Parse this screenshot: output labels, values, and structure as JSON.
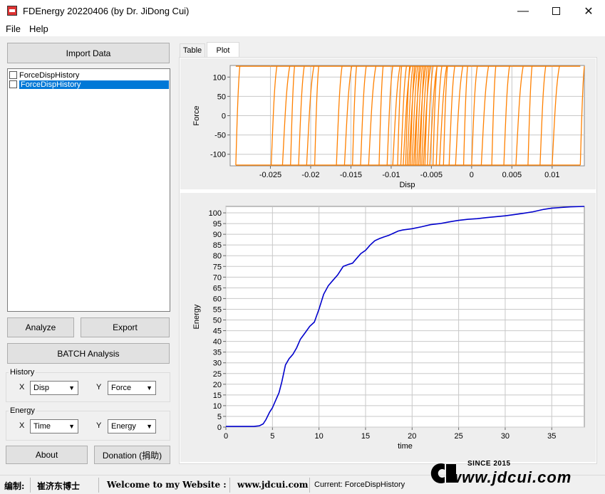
{
  "window": {
    "title": "FDEnergy 20220406 (by Dr. JiDong Cui)"
  },
  "menu": [
    "File",
    "Help"
  ],
  "left": {
    "import_label": "Import Data",
    "tree_items": [
      "ForceDispHistory",
      "ForceDispHistory"
    ],
    "analyze_label": "Analyze",
    "export_label": "Export",
    "batch_label": "BATCH Analysis",
    "history": {
      "label": "History",
      "x_label": "X",
      "y_label": "Y",
      "x_value": "Disp",
      "y_value": "Force"
    },
    "energy": {
      "label": "Energy",
      "x_label": "X",
      "y_label": "Y",
      "x_value": "Time",
      "y_value": "Energy"
    },
    "about_label": "About",
    "donation_label": "Donation (捐助)"
  },
  "tabs": [
    "Table",
    "Plot"
  ],
  "status": {
    "editor_label": "编制:",
    "editor_name": "崔济东博士",
    "welcome": "Welcome to my Website :",
    "website": "www.jdcui.com",
    "current": "Current: ForceDispHistory"
  },
  "brand": {
    "since": "SINCE 2015",
    "url": "www.jdcui.com"
  },
  "colors": {
    "hysteresis": "#ff8000",
    "energy": "#0000cc",
    "selection": "#0078d7"
  },
  "chart_data": [
    {
      "type": "line",
      "xlabel": "Disp",
      "ylabel": "Force",
      "xlim": [
        -0.03,
        0.014
      ],
      "ylim": [
        -130,
        130
      ],
      "xticks": [
        "-0.025",
        "-0.02",
        "-0.015",
        "-0.01",
        "-0.005",
        "0",
        "0.005",
        "0.01"
      ],
      "yticks": [
        "100",
        "50",
        "0",
        "-50",
        "-100"
      ],
      "grid": true,
      "force_levels": [
        -128,
        128
      ],
      "reversal_disps": [
        -0.0293,
        -0.0249,
        -0.0235,
        -0.0225,
        -0.0215,
        -0.0205,
        -0.0195,
        -0.0168,
        -0.0158,
        -0.0148,
        -0.0138,
        -0.0128,
        -0.0115,
        -0.0105,
        -0.0098,
        -0.0092,
        -0.0088,
        -0.0085,
        -0.0082,
        -0.008,
        -0.0078,
        -0.0076,
        -0.0074,
        -0.0072,
        -0.007,
        -0.0068,
        -0.0066,
        -0.0064,
        -0.0062,
        -0.006,
        -0.0058,
        -0.0055,
        -0.0052,
        -0.0048,
        -0.0044,
        -0.004,
        -0.0035,
        -0.0028,
        -0.002,
        -0.001,
        0.0,
        0.0012,
        0.0025,
        0.004,
        0.0055,
        0.007,
        0.0085,
        0.01,
        0.0135
      ]
    },
    {
      "type": "line",
      "xlabel": "time",
      "ylabel": "Energy",
      "xlim": [
        0,
        38.5
      ],
      "ylim": [
        0,
        103
      ],
      "xticks": [
        0,
        5,
        10,
        15,
        20,
        25,
        30,
        35
      ],
      "yticks": [
        0,
        5,
        10,
        15,
        20,
        25,
        30,
        35,
        40,
        45,
        50,
        55,
        60,
        65,
        70,
        75,
        80,
        85,
        90,
        95,
        100
      ],
      "grid": true,
      "x": [
        0,
        3.0,
        3.6,
        4.0,
        4.3,
        4.7,
        5.0,
        5.3,
        5.7,
        6.0,
        6.4,
        6.8,
        7.0,
        7.2,
        7.6,
        8.0,
        8.5,
        9.0,
        9.5,
        10.0,
        10.5,
        11.0,
        11.5,
        12.0,
        12.6,
        13.2,
        13.6,
        14.0,
        14.5,
        15.0,
        15.5,
        16.0,
        16.5,
        17.0,
        17.5,
        18.0,
        18.5,
        19.0,
        19.5,
        20.0,
        21.0,
        22.0,
        23.0,
        24.0,
        25.0,
        26.0,
        27.0,
        28.0,
        29.0,
        30.0,
        31.0,
        32.0,
        33.0,
        34.0,
        35.0,
        36.0,
        37.0,
        38.5
      ],
      "values": [
        0.3,
        0.3,
        0.6,
        1.5,
        3.5,
        7.0,
        9.0,
        12.0,
        16.0,
        21.0,
        29.0,
        32.0,
        33.0,
        34.0,
        37.0,
        41.0,
        44.0,
        47.0,
        49.0,
        55.0,
        62.0,
        66.0,
        68.5,
        71.0,
        75.0,
        76.0,
        76.5,
        78.5,
        81.0,
        82.5,
        85.0,
        87.0,
        88.0,
        88.8,
        89.5,
        90.5,
        91.5,
        92.0,
        92.3,
        92.6,
        93.5,
        94.5,
        95.0,
        95.8,
        96.5,
        97.0,
        97.3,
        97.8,
        98.2,
        98.6,
        99.2,
        99.8,
        100.5,
        101.5,
        102.2,
        102.5,
        102.8,
        103.0
      ]
    }
  ]
}
